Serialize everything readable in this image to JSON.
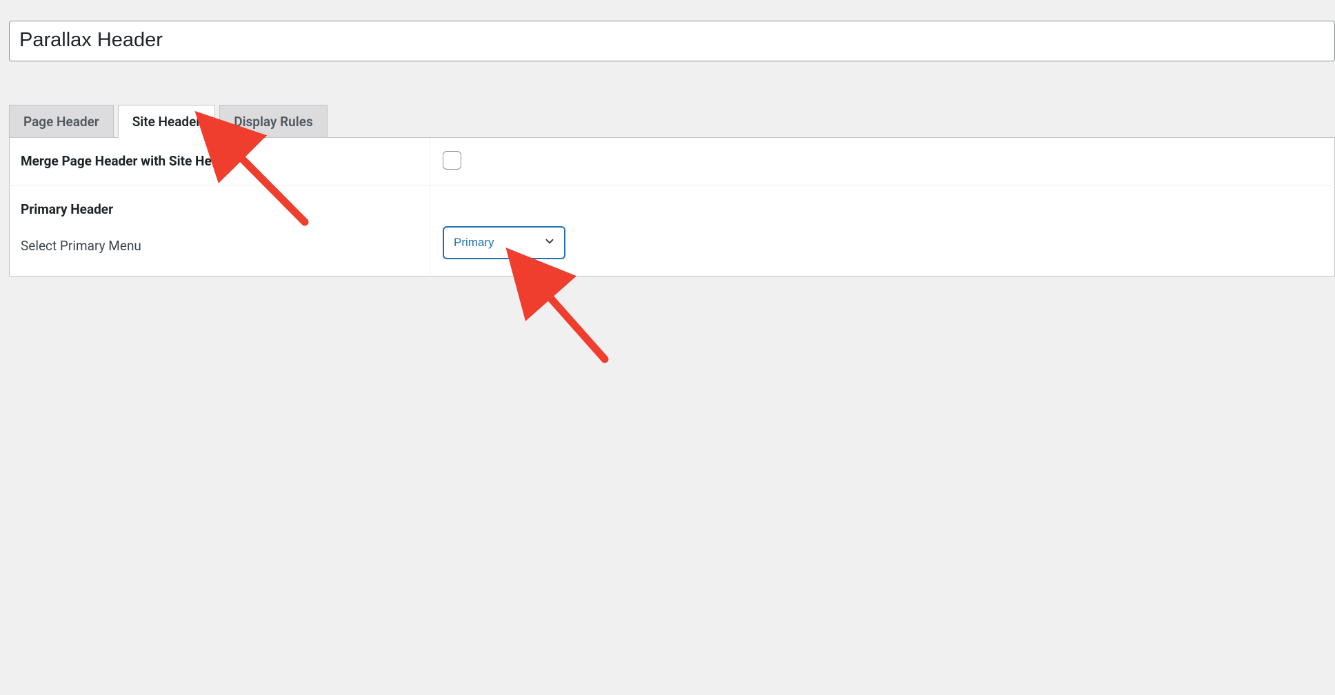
{
  "title_input": {
    "value": "Parallax Header"
  },
  "tabs": [
    {
      "id": "page-header",
      "label": "Page Header",
      "active": false
    },
    {
      "id": "site-header",
      "label": "Site Header",
      "active": true
    },
    {
      "id": "display-rules",
      "label": "Display Rules",
      "active": false
    }
  ],
  "site_header_options": {
    "merge_label": "Merge Page Header with Site Header",
    "merge_checked": false,
    "primary_header_heading": "Primary Header",
    "select_primary_menu_label": "Select Primary Menu",
    "select_primary_menu_value": "Primary"
  },
  "colors": {
    "accent": "#2271b1",
    "annotation": "#ef3e2e"
  }
}
